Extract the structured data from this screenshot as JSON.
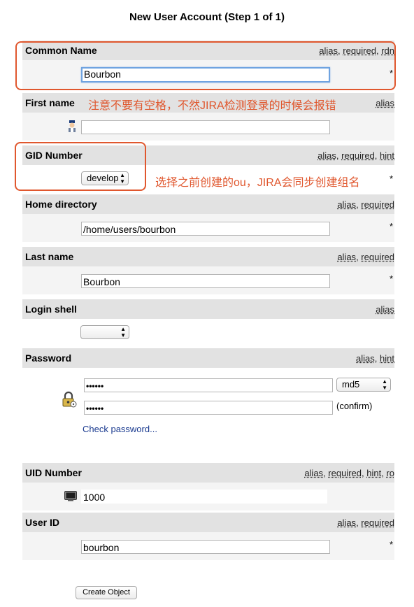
{
  "page": {
    "title": "New User Account (Step 1 of 1)"
  },
  "fields": {
    "common_name": {
      "label": "Common Name",
      "attrs": [
        "alias",
        "required",
        "rdn"
      ],
      "value": "Bourbon",
      "required_mark": "*"
    },
    "first_name": {
      "label": "First name",
      "attrs": [
        "alias"
      ],
      "value": ""
    },
    "gid_number": {
      "label": "GID Number",
      "attrs": [
        "alias",
        "required",
        "hint"
      ],
      "value": "develop",
      "required_mark": "*"
    },
    "home_directory": {
      "label": "Home directory",
      "attrs": [
        "alias",
        "required"
      ],
      "value": "/home/users/bourbon",
      "required_mark": "*"
    },
    "last_name": {
      "label": "Last name",
      "attrs": [
        "alias",
        "required"
      ],
      "value": "Bourbon",
      "required_mark": "*"
    },
    "login_shell": {
      "label": "Login shell",
      "attrs": [
        "alias"
      ],
      "value": ""
    },
    "password": {
      "label": "Password",
      "attrs": [
        "alias",
        "hint"
      ],
      "value": "••••••",
      "confirm_value": "••••••",
      "hash": "md5",
      "confirm_label": "(confirm)",
      "check_link": "Check password..."
    },
    "uid_number": {
      "label": "UID Number",
      "attrs": [
        "alias",
        "required",
        "hint",
        "ro"
      ],
      "value": "1000"
    },
    "user_id": {
      "label": "User ID",
      "attrs": [
        "alias",
        "required"
      ],
      "value": "bourbon",
      "required_mark": "*"
    }
  },
  "annotations": {
    "first_name_note": "注意不要有空格，不然JIRA检测登录的时候会报错",
    "gid_note": "选择之前创建的ou，JIRA会同步创建组名"
  },
  "submit": {
    "label": "Create Object"
  },
  "colors": {
    "annotation": "#e0572e",
    "row_header": "#e2e2e2",
    "row_body": "#f4f4f4",
    "focus": "#6fa3e0",
    "link": "#1a3a8f"
  }
}
